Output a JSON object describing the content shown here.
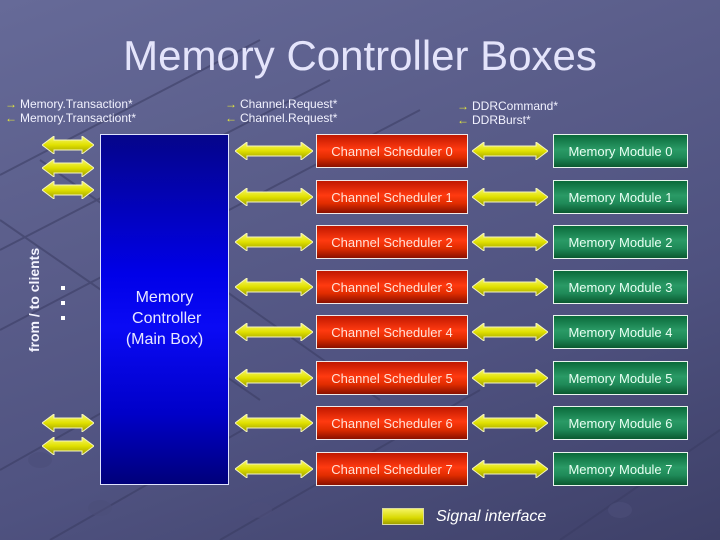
{
  "title": "Memory Controller Boxes",
  "signals": {
    "client": {
      "out": "Memory.Transaction*",
      "in": "Memory.Transactiont*"
    },
    "channel": {
      "out": "Channel.Request*",
      "in": "Channel.Request*"
    },
    "ddr": {
      "out": "DDRCommand*",
      "in": "DDRBurst*"
    },
    "arrow_out_glyph": "→",
    "arrow_in_glyph": "←"
  },
  "clients": {
    "label": "from / to clients",
    "ellipsis": "..."
  },
  "main_box": {
    "label": "Memory\n Controller\n(Main Box)"
  },
  "channels": [
    {
      "scheduler": "Channel Scheduler 0",
      "module": "Memory Module 0"
    },
    {
      "scheduler": "Channel Scheduler 1",
      "module": "Memory Module 1"
    },
    {
      "scheduler": "Channel Scheduler 2",
      "module": "Memory Module 2"
    },
    {
      "scheduler": "Channel Scheduler 3",
      "module": "Memory Module 3"
    },
    {
      "scheduler": "Channel Scheduler 4",
      "module": "Memory Module 4"
    },
    {
      "scheduler": "Channel Scheduler 5",
      "module": "Memory Module 5"
    },
    {
      "scheduler": "Channel Scheduler 6",
      "module": "Memory Module 6"
    },
    {
      "scheduler": "Channel Scheduler 7",
      "module": "Memory Module 7"
    }
  ],
  "legend": {
    "label": "Signal interface",
    "icon": "signal-interface-arrow"
  },
  "colors": {
    "main_box": "#0000e8",
    "scheduler": "#ff3a10",
    "module": "#2a9a66",
    "signal": "#e6e600"
  }
}
